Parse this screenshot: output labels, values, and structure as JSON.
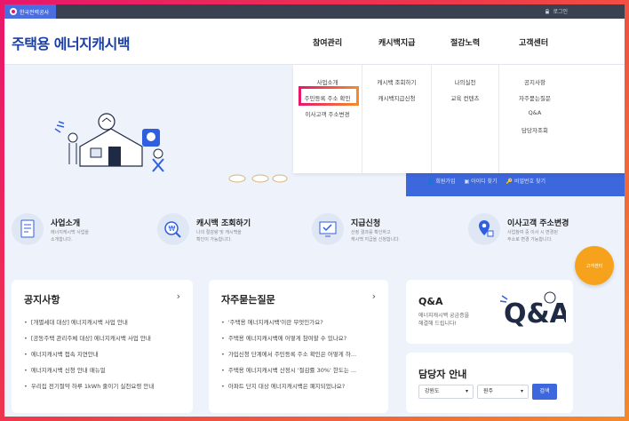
{
  "util": {
    "org_name": "한국전력공사",
    "login": "로그인"
  },
  "header": {
    "brand": "주택용 에너지캐시백",
    "nav": [
      "참여관리",
      "캐시백지급",
      "절감노력",
      "고객센터"
    ]
  },
  "mega_menu": {
    "col1": [
      "사업소개",
      "주민등록 주소 확인",
      "이사고객 주소변경"
    ],
    "col2": [
      "캐시백 조회하기",
      "캐시백지급신청"
    ],
    "col3": [
      "나의실천",
      "교육 컨텐츠"
    ],
    "col4": [
      "공지사항",
      "자주묻는질문",
      "Q&A",
      "담당자조회"
    ]
  },
  "hero": {
    "links": [
      "회원가입",
      "아이디 찾기",
      "비밀번호 찾기"
    ]
  },
  "quick": [
    {
      "title": "사업소개",
      "desc1": "에너지캐시백 사업을",
      "desc2": "소개합니다."
    },
    {
      "title": "캐시백 조회하기",
      "desc1": "나의 절감량 및 캐시백을",
      "desc2": "확인이 가능합니다."
    },
    {
      "title": "지급신청",
      "desc1": "산정 결과를 확인하고",
      "desc2": "캐시백 지급을 신청합니다."
    },
    {
      "title": "이사고객 주소변경",
      "desc1": "사업참여 중 이사 시 변경된",
      "desc2": "주소로 변경 가능합니다."
    }
  ],
  "fab_label": "고객센터",
  "notice": {
    "title": "공지사항",
    "items": [
      "[개별세대 대상] 에너지캐시백 사업 안내",
      "[공동주택 관리주체 대상] 에너지캐시백 사업 안내",
      "에너지캐시백 접속 지연안내",
      "에너지캐시백 신청 안내 매뉴얼",
      "우리집 전기절약 하루 1kWh 줄이기 실천요령 안내"
    ]
  },
  "faq": {
    "title": "자주묻는질문",
    "items": [
      "'주택용 에너지캐시백'이란 무엇인가요?",
      "주택용 에너지캐시백에 어떻게 참여할 수 있나요?",
      "가입신청 단계에서 주민등록 주소 확인은 어떻게 하...",
      "주택용 에너지캐시백 산정시 '절감률 30%' 한도는 ...",
      "아파트 단지 대상 에너지캐시백은 폐지되었나요?"
    ]
  },
  "qna": {
    "title": "Q&A",
    "desc1": "에너지캐시백 궁금증을",
    "desc2": "해결해 드립니다!",
    "art": "Q&A"
  },
  "manager": {
    "title": "담당자 안내",
    "region": "강원도",
    "city": "원주",
    "search": "검색"
  },
  "colors": {
    "primary": "#3d67dc",
    "brand": "#1b3fa6",
    "fab": "#f7a21c",
    "highlight_start": "#e8176b",
    "highlight_end": "#f58a2a"
  }
}
